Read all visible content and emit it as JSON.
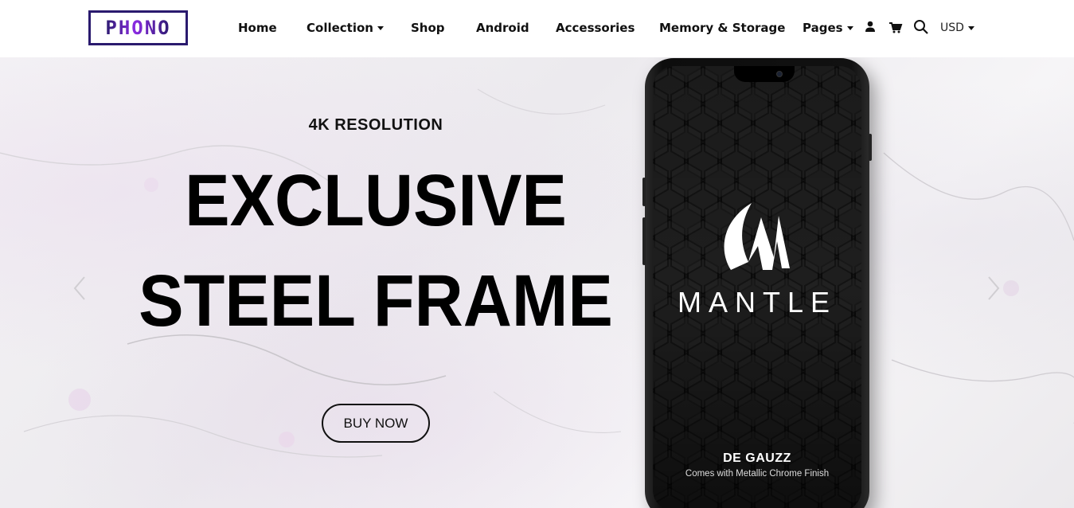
{
  "header": {
    "logo_text": "PHONO",
    "nav": [
      {
        "label": "Home",
        "has_dropdown": false
      },
      {
        "label": "Collection",
        "has_dropdown": true
      },
      {
        "label": "Shop",
        "has_dropdown": false
      },
      {
        "label": "Android",
        "has_dropdown": false
      },
      {
        "label": "Accessories",
        "has_dropdown": false
      },
      {
        "label": "Memory & Storage",
        "has_dropdown": false
      },
      {
        "label": "Pages",
        "has_dropdown": true
      }
    ],
    "icons": [
      "user-icon",
      "cart-icon",
      "search-icon"
    ],
    "currency": "USD"
  },
  "hero": {
    "subtitle": "4K RESOLUTION",
    "headline_line1": "EXCLUSIVE",
    "headline_line2": "STEEL FRAME",
    "button_label": "BUY NOW",
    "phone": {
      "brand": "MANTLE",
      "model": "DE GAUZZ",
      "tagline": "Comes with Metallic Chrome Finish"
    }
  },
  "colors": {
    "logo": "#2a1a6e",
    "logo_accent": "#8a2be2",
    "text": "#111111"
  }
}
